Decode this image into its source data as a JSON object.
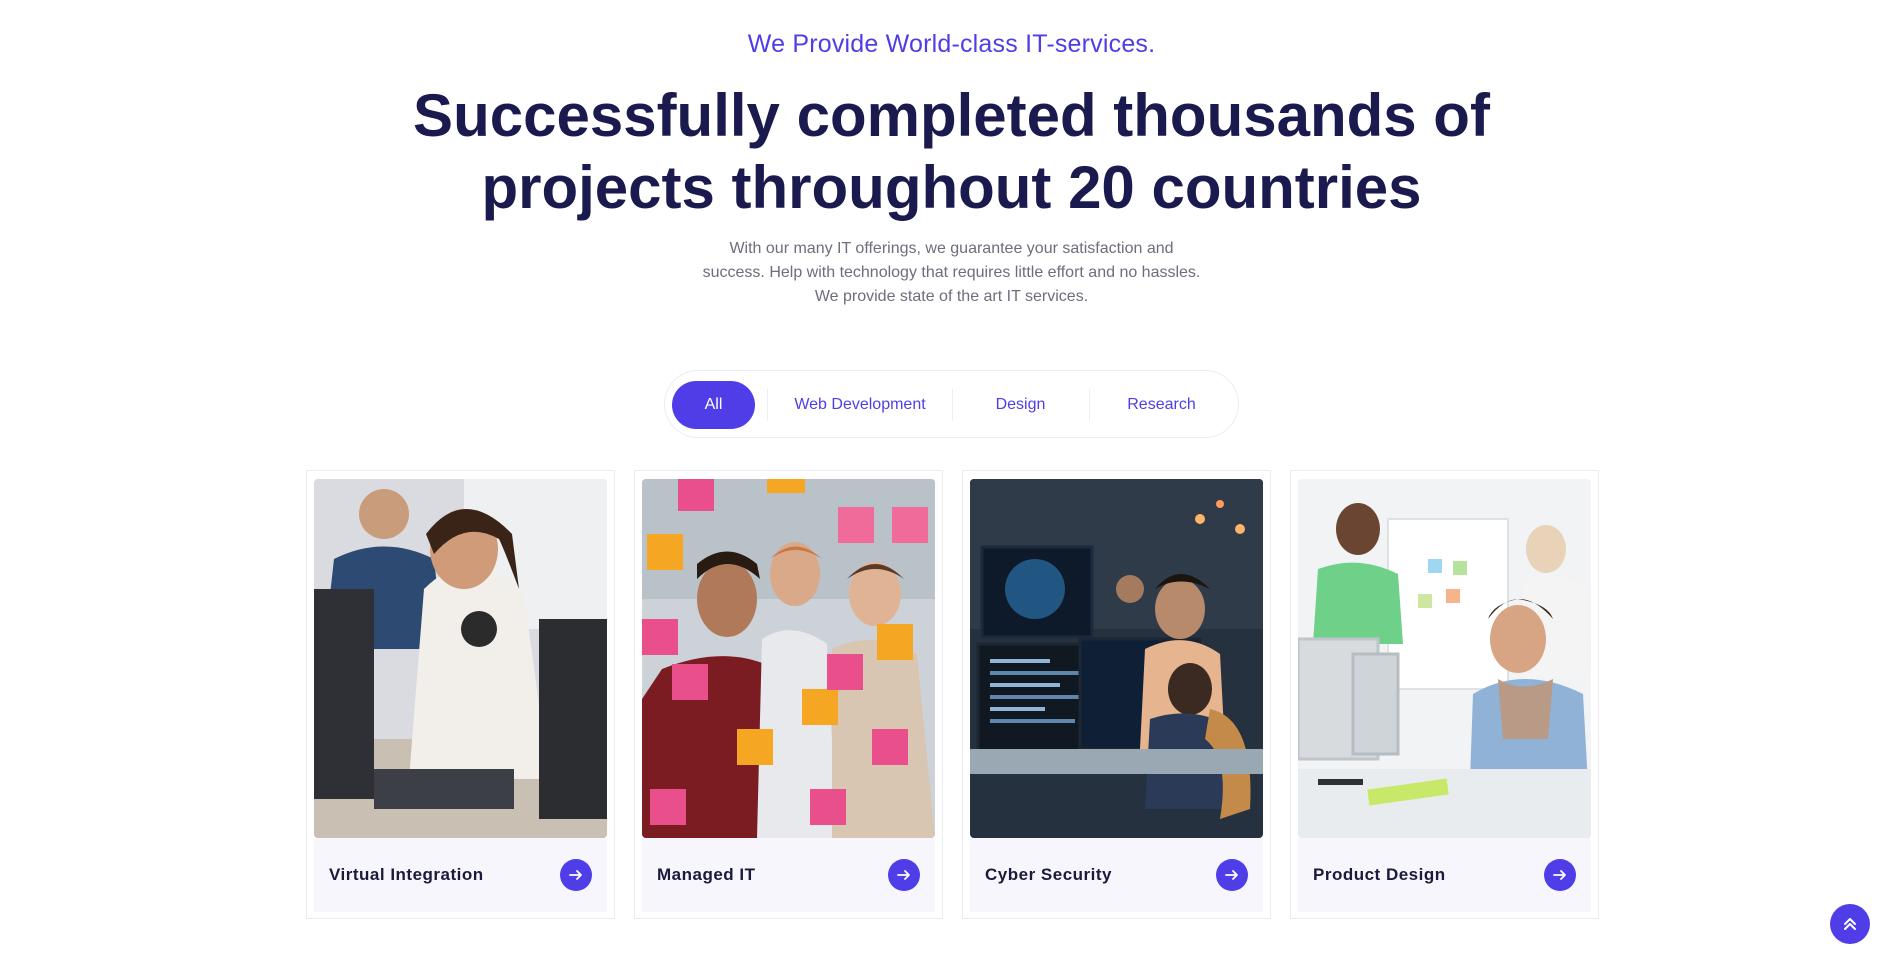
{
  "header": {
    "eyebrow": "We Provide World-class IT-services.",
    "headline_line1": "Successfully completed thousands of",
    "headline_line2": "projects throughout 20 countries",
    "description_line1": "With our many IT offerings, we guarantee your satisfaction and",
    "description_line2": "success. Help with technology that requires little effort and no hassles.",
    "description_line3": "We provide state of the art IT services."
  },
  "filters": {
    "active": "All",
    "tabs": [
      "All",
      "Web Development",
      "Design",
      "Research"
    ]
  },
  "cards": [
    {
      "title": "Virtual Integration",
      "image": "woman-at-computer-photo",
      "arrow_icon": "arrow-right-icon"
    },
    {
      "title": "Managed IT",
      "image": "team-sticky-notes-photo",
      "arrow_icon": "arrow-right-icon"
    },
    {
      "title": "Cyber Security",
      "image": "monitors-coding-photo",
      "arrow_icon": "arrow-right-icon"
    },
    {
      "title": "Product Design",
      "image": "woman-drawing-tablet-photo",
      "arrow_icon": "arrow-right-icon"
    }
  ],
  "scroll_top": {
    "icon": "double-chevron-up-icon"
  },
  "colors": {
    "accent": "#4f3ee8",
    "heading": "#1b1a4f",
    "body_text": "#6d6d7c",
    "card_footer": "#f7f6fd"
  }
}
